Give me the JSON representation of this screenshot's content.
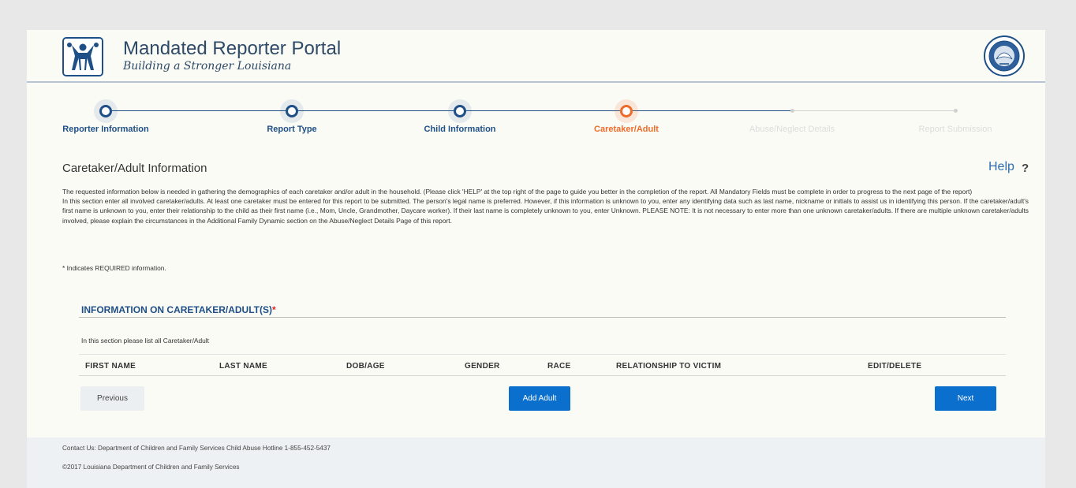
{
  "header": {
    "title": "Mandated Reporter Portal",
    "subtitle": "Building a Stronger Louisiana",
    "logo_icon": "family-logo-icon",
    "seal_icon": "louisiana-state-seal-icon"
  },
  "stepper": {
    "steps": [
      {
        "label": "Reporter Information",
        "state": "complete"
      },
      {
        "label": "Report Type",
        "state": "complete"
      },
      {
        "label": "Child Information",
        "state": "complete"
      },
      {
        "label": "Caretaker/Adult",
        "state": "active"
      },
      {
        "label": "Abuse/Neglect Details",
        "state": "future"
      },
      {
        "label": "Report Submission",
        "state": "future"
      }
    ]
  },
  "section": {
    "title": "Caretaker/Adult Information",
    "help_label": "Help",
    "help_icon": "?",
    "intro_1": "The requested information below is needed in gathering the demographics of each caretaker and/or adult in the household. (Please click 'HELP' at the top right of the page to guide you better in the completion of the report. All Mandatory Fields must be complete in order to progress to the next page of the report)",
    "intro_2": "In this section enter all involved caretaker/adults. At least one caretaker must be entered for this report to be submitted. The person's legal name is preferred. However, if this information is unknown to you, enter any identifying data such as last name, nickname or initials to assist us in identifying this person. If the caretaker/adult's first name is unknown to you, enter their relationship to the child as their first name (i.e., Mom, Uncle, Grandmother, Daycare worker). If their last name is completely unknown to you, enter Unknown. PLEASE NOTE: It is not necessary to enter more than one unknown caretaker/adults. If there are multiple unknown caretaker/adults involved, please explain the circumstances in the Additional Family Dynamic section on the Abuse/Neglect Details Page of this report.",
    "required_note": "* Indicates REQUIRED information."
  },
  "caretakers": {
    "heading": "INFORMATION ON CARETAKER/ADULT(S)",
    "required_marker": "*",
    "note": "In this section please list all Caretaker/Adult",
    "columns": [
      "FIRST NAME",
      "LAST NAME",
      "DOB/AGE",
      "GENDER",
      "RACE",
      "RELATIONSHIP TO VICTIM",
      "EDIT/DELETE"
    ],
    "rows": []
  },
  "buttons": {
    "previous": "Previous",
    "add_adult": "Add Adult",
    "next": "Next"
  },
  "footer": {
    "contact": "Contact Us: Department of Children and Family Services Child Abuse Hotline 1-855-452-5437",
    "copyright": "©2017 Louisiana Department of Children and Family Services"
  },
  "colors": {
    "brand_blue": "#1e4f86",
    "active_orange": "#ee6c2b",
    "button_blue": "#0b6fce",
    "link_blue": "#2f6db1"
  }
}
